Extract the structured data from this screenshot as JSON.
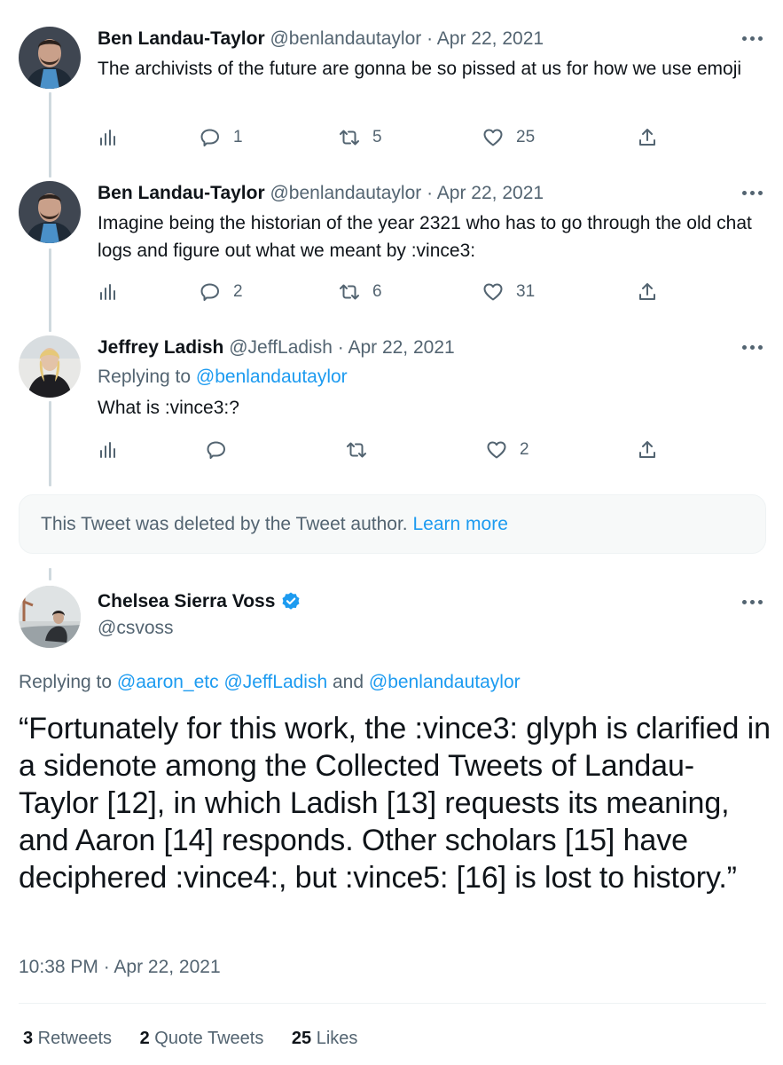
{
  "tweets": [
    {
      "name": "Ben Landau-Taylor",
      "handle": "@benlandautaylor",
      "sep": "·",
      "date": "Apr 22, 2021",
      "text": "The archivists of the future are gonna be so pissed at us for how we use emoji",
      "replies": "1",
      "retweets": "5",
      "likes": "25"
    },
    {
      "name": "Ben Landau-Taylor",
      "handle": "@benlandautaylor",
      "sep": "·",
      "date": "Apr 22, 2021",
      "text": "Imagine being the historian of the year 2321 who has to go through the old chat logs and figure out what we meant by :vince3:",
      "replies": "2",
      "retweets": "6",
      "likes": "31"
    },
    {
      "name": "Jeffrey Ladish",
      "handle": "@JeffLadish",
      "sep": "·",
      "date": "Apr 22, 2021",
      "replying_prefix": "Replying to ",
      "replying_to": "@benlandautaylor",
      "text": "What is :vince3:?",
      "replies": "",
      "retweets": "",
      "likes": "2"
    }
  ],
  "deleted": {
    "text": "This Tweet was deleted by the Tweet author. ",
    "link": "Learn more"
  },
  "main": {
    "name": "Chelsea Sierra Voss",
    "handle": "@csvoss",
    "replying_prefix": "Replying to ",
    "mention1": "@aaron_etc",
    "mention2": "@JeffLadish",
    "and": " and ",
    "mention3": "@benlandautaylor",
    "text": "“Fortunately for this work, the :vince3: glyph is clarified in a sidenote among the Collected Tweets of Landau-Taylor [12], in which Ladish [13] requests its meaning, and Aaron [14] responds. Other scholars [15] have deciphered :vince4:, but :vince5: [16] is lost to history.”",
    "timestamp": "10:38 PM · Apr 22, 2021",
    "retweets_count": "3",
    "retweets_label": " Retweets",
    "quotes_count": "2",
    "quotes_label": " Quote Tweets",
    "likes_count": "25",
    "likes_label": " Likes"
  },
  "colors": {
    "accent": "#1d9bf0",
    "secondary_text": "#536471",
    "text": "#0f1419"
  }
}
